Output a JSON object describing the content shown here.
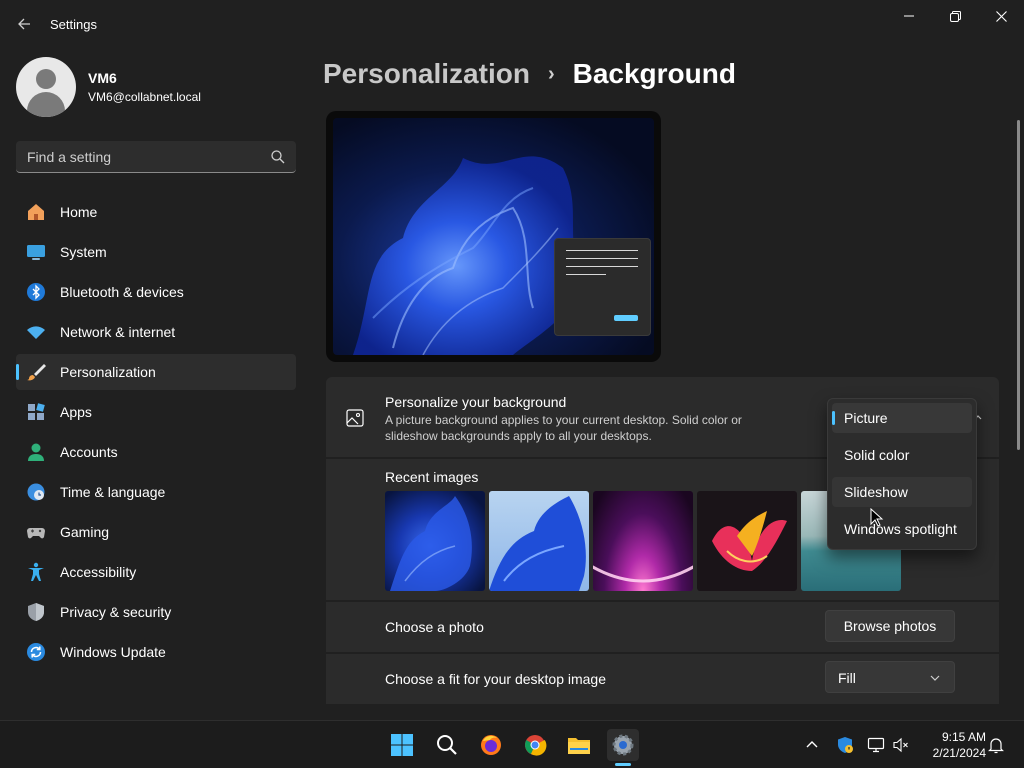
{
  "window": {
    "title": "Settings"
  },
  "profile": {
    "name": "VM6",
    "email": "VM6@collabnet.local"
  },
  "search": {
    "placeholder": "Find a setting"
  },
  "sidebar": {
    "items": [
      {
        "label": "Home",
        "icon": "home-icon"
      },
      {
        "label": "System",
        "icon": "system-icon"
      },
      {
        "label": "Bluetooth & devices",
        "icon": "bluetooth-icon"
      },
      {
        "label": "Network & internet",
        "icon": "wifi-icon"
      },
      {
        "label": "Personalization",
        "icon": "brush-icon",
        "active": true
      },
      {
        "label": "Apps",
        "icon": "apps-icon"
      },
      {
        "label": "Accounts",
        "icon": "accounts-icon"
      },
      {
        "label": "Time & language",
        "icon": "clock-globe-icon"
      },
      {
        "label": "Gaming",
        "icon": "gamepad-icon"
      },
      {
        "label": "Accessibility",
        "icon": "accessibility-icon"
      },
      {
        "label": "Privacy & security",
        "icon": "shield-icon"
      },
      {
        "label": "Windows Update",
        "icon": "update-icon"
      }
    ]
  },
  "breadcrumb": {
    "parent": "Personalization",
    "separator": "›",
    "current": "Background"
  },
  "background_settings": {
    "title": "Personalize your background",
    "description": "A picture background applies to your current desktop. Solid color or slideshow backgrounds apply to all your desktops.",
    "dropdown_options": [
      "Picture",
      "Solid color",
      "Slideshow",
      "Windows spotlight"
    ],
    "selected": "Picture",
    "hovered": "Slideshow"
  },
  "recent_images": {
    "title": "Recent images"
  },
  "choose_photo": {
    "title": "Choose a photo",
    "button_label": "Browse photos"
  },
  "choose_fit": {
    "title": "Choose a fit for your desktop image",
    "value": "Fill"
  },
  "taskbar": {
    "apps": [
      "start-icon",
      "search-icon",
      "firefox-icon",
      "chrome-icon",
      "file-explorer-icon",
      "settings-icon"
    ],
    "time": "9:15 AM",
    "date": "2/21/2024"
  },
  "colors": {
    "accent": "#4cc2ff",
    "background": "#202020",
    "card": "#2b2b2b"
  }
}
